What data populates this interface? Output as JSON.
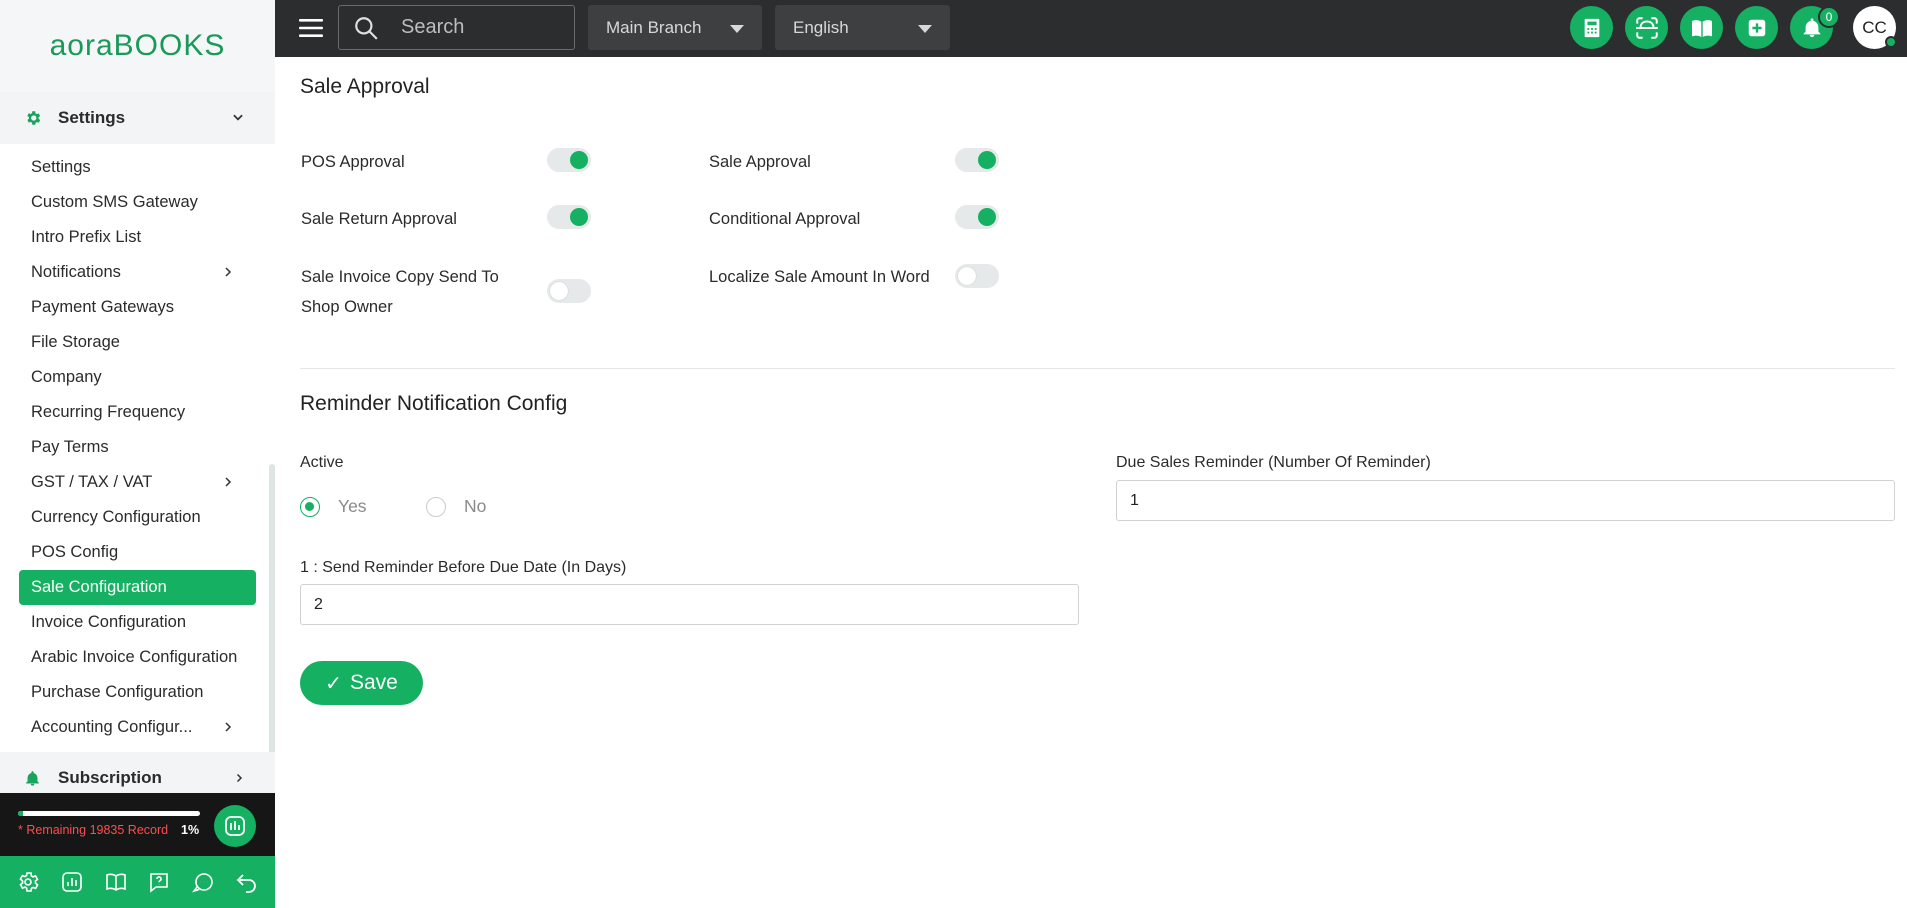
{
  "app": {
    "logo_text_a": "aora",
    "logo_text_b": "BOOKS"
  },
  "sidebar": {
    "section_title": "Settings",
    "items": [
      {
        "label": "Settings",
        "has_submenu": false
      },
      {
        "label": "Custom SMS Gateway",
        "has_submenu": false
      },
      {
        "label": "Intro Prefix List",
        "has_submenu": false
      },
      {
        "label": "Notifications",
        "has_submenu": true
      },
      {
        "label": "Payment Gateways",
        "has_submenu": false
      },
      {
        "label": "File Storage",
        "has_submenu": false
      },
      {
        "label": "Company",
        "has_submenu": false
      },
      {
        "label": "Recurring Frequency",
        "has_submenu": false
      },
      {
        "label": "Pay Terms",
        "has_submenu": false
      },
      {
        "label": "GST / TAX / VAT",
        "has_submenu": true
      },
      {
        "label": "Currency Configuration",
        "has_submenu": false
      },
      {
        "label": "POS Config",
        "has_submenu": false
      },
      {
        "label": "Sale Configuration",
        "has_submenu": false,
        "active": true
      },
      {
        "label": "Invoice Configuration",
        "has_submenu": false
      },
      {
        "label": "Arabic Invoice Configuration",
        "has_submenu": false
      },
      {
        "label": "Purchase Configuration",
        "has_submenu": false
      },
      {
        "label": "Accounting Configur...",
        "has_submenu": true
      }
    ],
    "subscription_title": "Subscription",
    "usage": {
      "remaining_text": "* Remaining 19835 Record",
      "percent_text": "1%",
      "percent": 1
    }
  },
  "topbar": {
    "search_placeholder": "Search",
    "branch": "Main Branch",
    "language": "English",
    "notification_count": "0",
    "avatar_initials": "CC"
  },
  "sale_approval": {
    "title": "Sale Approval",
    "toggles": [
      {
        "label": "POS Approval",
        "on": true
      },
      {
        "label": "Sale Approval",
        "on": true
      },
      {
        "label": "Sale Return Approval",
        "on": true
      },
      {
        "label": "Conditional Approval",
        "on": true
      },
      {
        "label": "Sale Invoice Copy Send To Shop Owner",
        "on": false
      },
      {
        "label": "Localize Sale Amount In Word",
        "on": false
      }
    ]
  },
  "reminder": {
    "title": "Reminder Notification Config",
    "active_label": "Active",
    "yes_label": "Yes",
    "no_label": "No",
    "active_value": "Yes",
    "due_label": "Due Sales Reminder (Number Of Reminder)",
    "due_value": "1",
    "days_label": "1 : Send Reminder Before Due Date (In Days)",
    "days_value": "2"
  },
  "actions": {
    "save_label": "Save"
  },
  "colors": {
    "accent": "#16b063",
    "topbar": "#2c2d2e"
  }
}
